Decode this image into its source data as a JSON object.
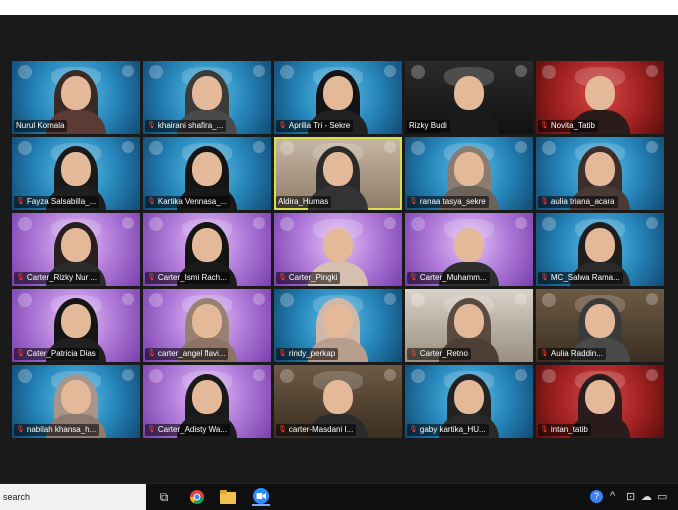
{
  "gallery": {
    "tiles": [
      {
        "name": "Nurul Komala",
        "bg": "blue",
        "mic": false,
        "hijab": "#3a2a25",
        "body": "#5c3a35"
      },
      {
        "name": "khairani shafira_...",
        "bg": "blue",
        "mic": true,
        "hijab": "#3d3a3a",
        "body": "#4a4a4a"
      },
      {
        "name": "Aprilia Tri - Sekre",
        "bg": "blue",
        "mic": true,
        "hijab": "#141414",
        "body": "#222"
      },
      {
        "name": "Rizky Budi",
        "bg": "dark",
        "mic": false,
        "hijab": "",
        "body": "#1b1b1b"
      },
      {
        "name": "Novita_Tatib",
        "bg": "red",
        "mic": true,
        "hijab": "",
        "body": "#2a1a1a"
      },
      {
        "name": "Fayza Salsabilla_...",
        "bg": "blue",
        "mic": true,
        "hijab": "#1a1a1a",
        "body": "#1f1f1f"
      },
      {
        "name": "Kartika Vennasa_...",
        "bg": "blue",
        "mic": true,
        "hijab": "#151515",
        "body": "#181818"
      },
      {
        "name": "Aldira_Humas",
        "bg": "room",
        "mic": false,
        "hijab": "#2a2a2a",
        "body": "#333"
      },
      {
        "name": "ranaa tasya_sekre",
        "bg": "blue",
        "mic": true,
        "hijab": "#8a7a70",
        "body": "#6d625a"
      },
      {
        "name": "aulia triana_acara",
        "bg": "blue",
        "mic": true,
        "hijab": "#3b2e2b",
        "body": "#4a3a36"
      },
      {
        "name": "Carter_Rizky Nur ...",
        "bg": "purple",
        "mic": true,
        "hijab": "#2a1e1e",
        "body": "#2b2b2b"
      },
      {
        "name": "Carter_Ismi Rach...",
        "bg": "purple",
        "mic": true,
        "hijab": "#141414",
        "body": "#1b1b1b"
      },
      {
        "name": "Carter_Pingki",
        "bg": "purple",
        "mic": true,
        "hijab": "",
        "body": "#d8c0b0"
      },
      {
        "name": "Carter_Muhamm...",
        "bg": "purple",
        "mic": true,
        "hijab": "",
        "body": "#2e2e2e"
      },
      {
        "name": "MC_Salwa Rama...",
        "bg": "blue",
        "mic": true,
        "hijab": "#1e1e1e",
        "body": "#2a2a2a"
      },
      {
        "name": "Cater_Patricia Dias",
        "bg": "purple",
        "mic": true,
        "hijab": "#151515",
        "body": "#202020"
      },
      {
        "name": "carter_angel flavi...",
        "bg": "purple",
        "mic": true,
        "hijab": "#9a8070",
        "body": "#8c7566"
      },
      {
        "name": "rindy_perkap",
        "bg": "blue",
        "mic": true,
        "hijab": "#d0b8a8",
        "body": "#b89e8c"
      },
      {
        "name": "Carter_Retno",
        "bg": "room2",
        "mic": true,
        "hijab": "#5a4a40",
        "body": "#4d3f36"
      },
      {
        "name": "Aulia Raddin...",
        "bg": "wood",
        "mic": true,
        "hijab": "#3a3a3a",
        "body": "#4a4a4a"
      },
      {
        "name": "nabilah khansa_h...",
        "bg": "blue",
        "mic": true,
        "hijab": "#a8958a",
        "body": "#8e7b70"
      },
      {
        "name": "Carter_Adisty Wa...",
        "bg": "purple",
        "mic": true,
        "hijab": "#1a1a1a",
        "body": "#1c1c1c"
      },
      {
        "name": "carter-Masdani I...",
        "bg": "wood",
        "mic": true,
        "hijab": "",
        "body": "#2b2b2b"
      },
      {
        "name": "gaby kartika_HU...",
        "bg": "blue",
        "mic": true,
        "hijab": "#222",
        "body": "#2a2a2a"
      },
      {
        "name": "intan_tatib",
        "bg": "red",
        "mic": true,
        "hijab": "#2a1c1c",
        "body": "#2a1c1c"
      }
    ],
    "active_speaker_index": 7
  },
  "taskbar": {
    "search_label": "search",
    "apps": [
      {
        "icon": "task-view-icon",
        "glyph": "⧉",
        "active": false
      },
      {
        "icon": "chrome-icon",
        "glyph": "●",
        "active": false
      },
      {
        "icon": "file-explorer-icon",
        "glyph": "▬",
        "active": false
      },
      {
        "icon": "zoom-icon",
        "glyph": "▶",
        "active": true
      }
    ],
    "tray": [
      {
        "icon": "help-icon",
        "glyph": "?"
      },
      {
        "icon": "chevron-up-icon",
        "glyph": "^"
      },
      {
        "icon": "network-icon",
        "glyph": "⊡"
      },
      {
        "icon": "cloud-icon",
        "glyph": "☁"
      },
      {
        "icon": "battery-icon",
        "glyph": "▭"
      }
    ]
  }
}
